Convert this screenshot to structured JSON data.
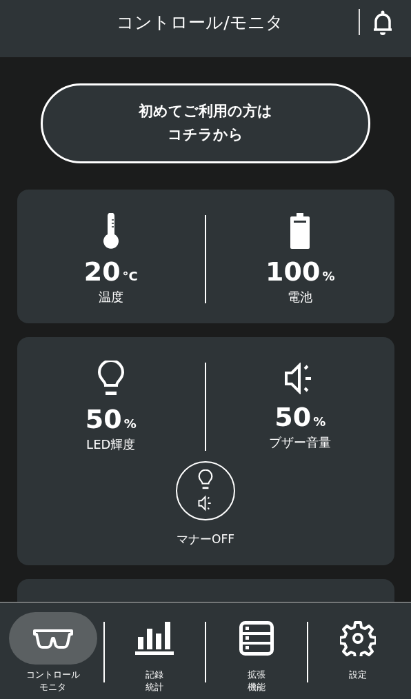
{
  "header": {
    "title": "コントロール/モニタ"
  },
  "guide_button": {
    "label": "初めてご利用の方はコチラから"
  },
  "status_card": {
    "items": [
      {
        "kind": "thermometer",
        "value": "20",
        "unit": "°C",
        "label": "温度"
      },
      {
        "kind": "battery",
        "value": "100",
        "unit": "%",
        "label": "電池"
      }
    ]
  },
  "control_card": {
    "items": [
      {
        "kind": "bulb",
        "value": "50",
        "unit": "%",
        "label": "LED輝度"
      },
      {
        "kind": "speaker",
        "value": "50",
        "unit": "%",
        "label": "ブザー音量"
      }
    ],
    "manner": {
      "label": "マナーOFF"
    }
  },
  "nav": [
    {
      "kind": "glasses",
      "label": "コントロールモニタ",
      "selected": true
    },
    {
      "kind": "chart",
      "label": "記録統計",
      "selected": false
    },
    {
      "kind": "list",
      "label": "拡張機能",
      "selected": false
    },
    {
      "kind": "gear",
      "label": "設定",
      "selected": false
    }
  ]
}
